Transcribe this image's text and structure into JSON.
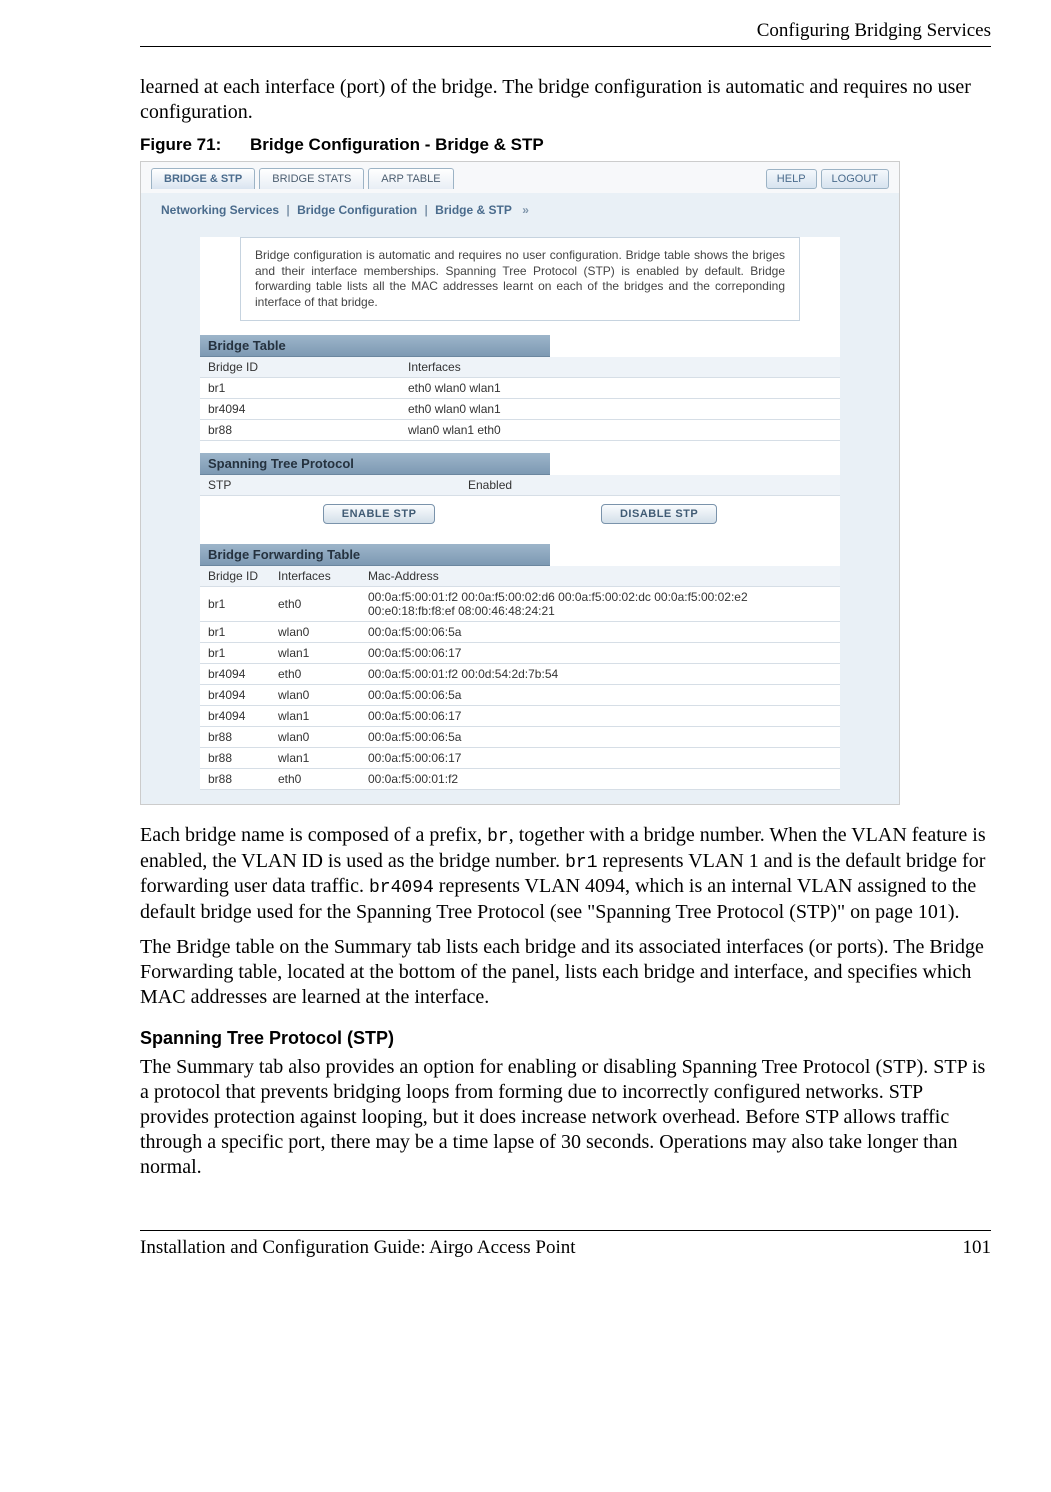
{
  "header": {
    "title": "Configuring Bridging Services"
  },
  "intro": "learned at each interface (port) of the bridge. The bridge configuration is automatic and requires no user configuration.",
  "figure": {
    "num": "Figure 71:",
    "title": "Bridge Configuration - Bridge & STP"
  },
  "screenshot": {
    "tabs": [
      {
        "label": "BRIDGE & STP",
        "active": true
      },
      {
        "label": "BRIDGE STATS",
        "active": false
      },
      {
        "label": "ARP TABLE",
        "active": false
      }
    ],
    "header_buttons": {
      "help": "HELP",
      "logout": "LOGOUT"
    },
    "breadcrumb": [
      "Networking Services",
      "Bridge Configuration",
      "Bridge & STP"
    ],
    "infobox": "Bridge configuration is automatic and requires no user configuration. Bridge table shows the briges and their interface memberships. Spanning Tree Protocol (STP) is enabled by default. Bridge forwarding table lists all the MAC addresses learnt on each of the bridges and the correponding interface of that bridge.",
    "bridge_table": {
      "title": "Bridge Table",
      "headers": [
        "Bridge ID",
        "Interfaces"
      ],
      "rows": [
        [
          "br1",
          "eth0 wlan0 wlan1"
        ],
        [
          "br4094",
          "eth0 wlan0 wlan1"
        ],
        [
          "br88",
          "wlan0 wlan1 eth0"
        ]
      ]
    },
    "stp": {
      "title": "Spanning Tree Protocol",
      "headers": [
        "STP",
        "Enabled"
      ],
      "buttons": {
        "enable": "ENABLE STP",
        "disable": "DISABLE STP"
      }
    },
    "fwd_table": {
      "title": "Bridge Forwarding Table",
      "headers": [
        "Bridge ID",
        "Interfaces",
        "Mac-Address"
      ],
      "rows": [
        [
          "br1",
          "eth0",
          "00:0a:f5:00:01:f2 00:0a:f5:00:02:d6 00:0a:f5:00:02:dc 00:0a:f5:00:02:e2 00:e0:18:fb:f8:ef 08:00:46:48:24:21"
        ],
        [
          "br1",
          "wlan0",
          "00:0a:f5:00:06:5a"
        ],
        [
          "br1",
          "wlan1",
          "00:0a:f5:00:06:17"
        ],
        [
          "br4094",
          "eth0",
          "00:0a:f5:00:01:f2 00:0d:54:2d:7b:54"
        ],
        [
          "br4094",
          "wlan0",
          "00:0a:f5:00:06:5a"
        ],
        [
          "br4094",
          "wlan1",
          "00:0a:f5:00:06:17"
        ],
        [
          "br88",
          "wlan0",
          "00:0a:f5:00:06:5a"
        ],
        [
          "br88",
          "wlan1",
          "00:0a:f5:00:06:17"
        ],
        [
          "br88",
          "eth0",
          "00:0a:f5:00:01:f2"
        ]
      ]
    }
  },
  "para1_a": "Each bridge name is composed of a prefix, ",
  "para1_code1": "br",
  "para1_b": ", together with a bridge number. When the VLAN feature is enabled, the VLAN ID is used as the bridge number. ",
  "para1_code2": "br1",
  "para1_c": " represents VLAN 1 and is the default bridge for forwarding user data traffic. ",
  "para1_code3": "br4094",
  "para1_d": " represents VLAN 4094, which is an internal VLAN assigned to the default bridge used for the Spanning Tree Protocol (see \"Spanning Tree Protocol (STP)\" on page 101).",
  "para2": "The Bridge table on the Summary tab lists each bridge and its associated interfaces (or ports). The Bridge Forwarding table, located at the bottom of the panel, lists each bridge and interface, and specifies which MAC addresses are learned at the interface.",
  "subhead": "Spanning Tree Protocol (STP)",
  "para3": "The Summary tab also provides an option for enabling or disabling Spanning Tree Protocol (STP). STP is a protocol that prevents bridging loops from forming due to incorrectly configured networks. STP provides protection against looping, but it does increase network overhead. Before STP allows traffic through a specific port, there may be a time lapse of 30 seconds. Operations may also take longer than normal.",
  "footer": {
    "left": "Installation and Configuration Guide: Airgo Access Point",
    "right": "101"
  }
}
